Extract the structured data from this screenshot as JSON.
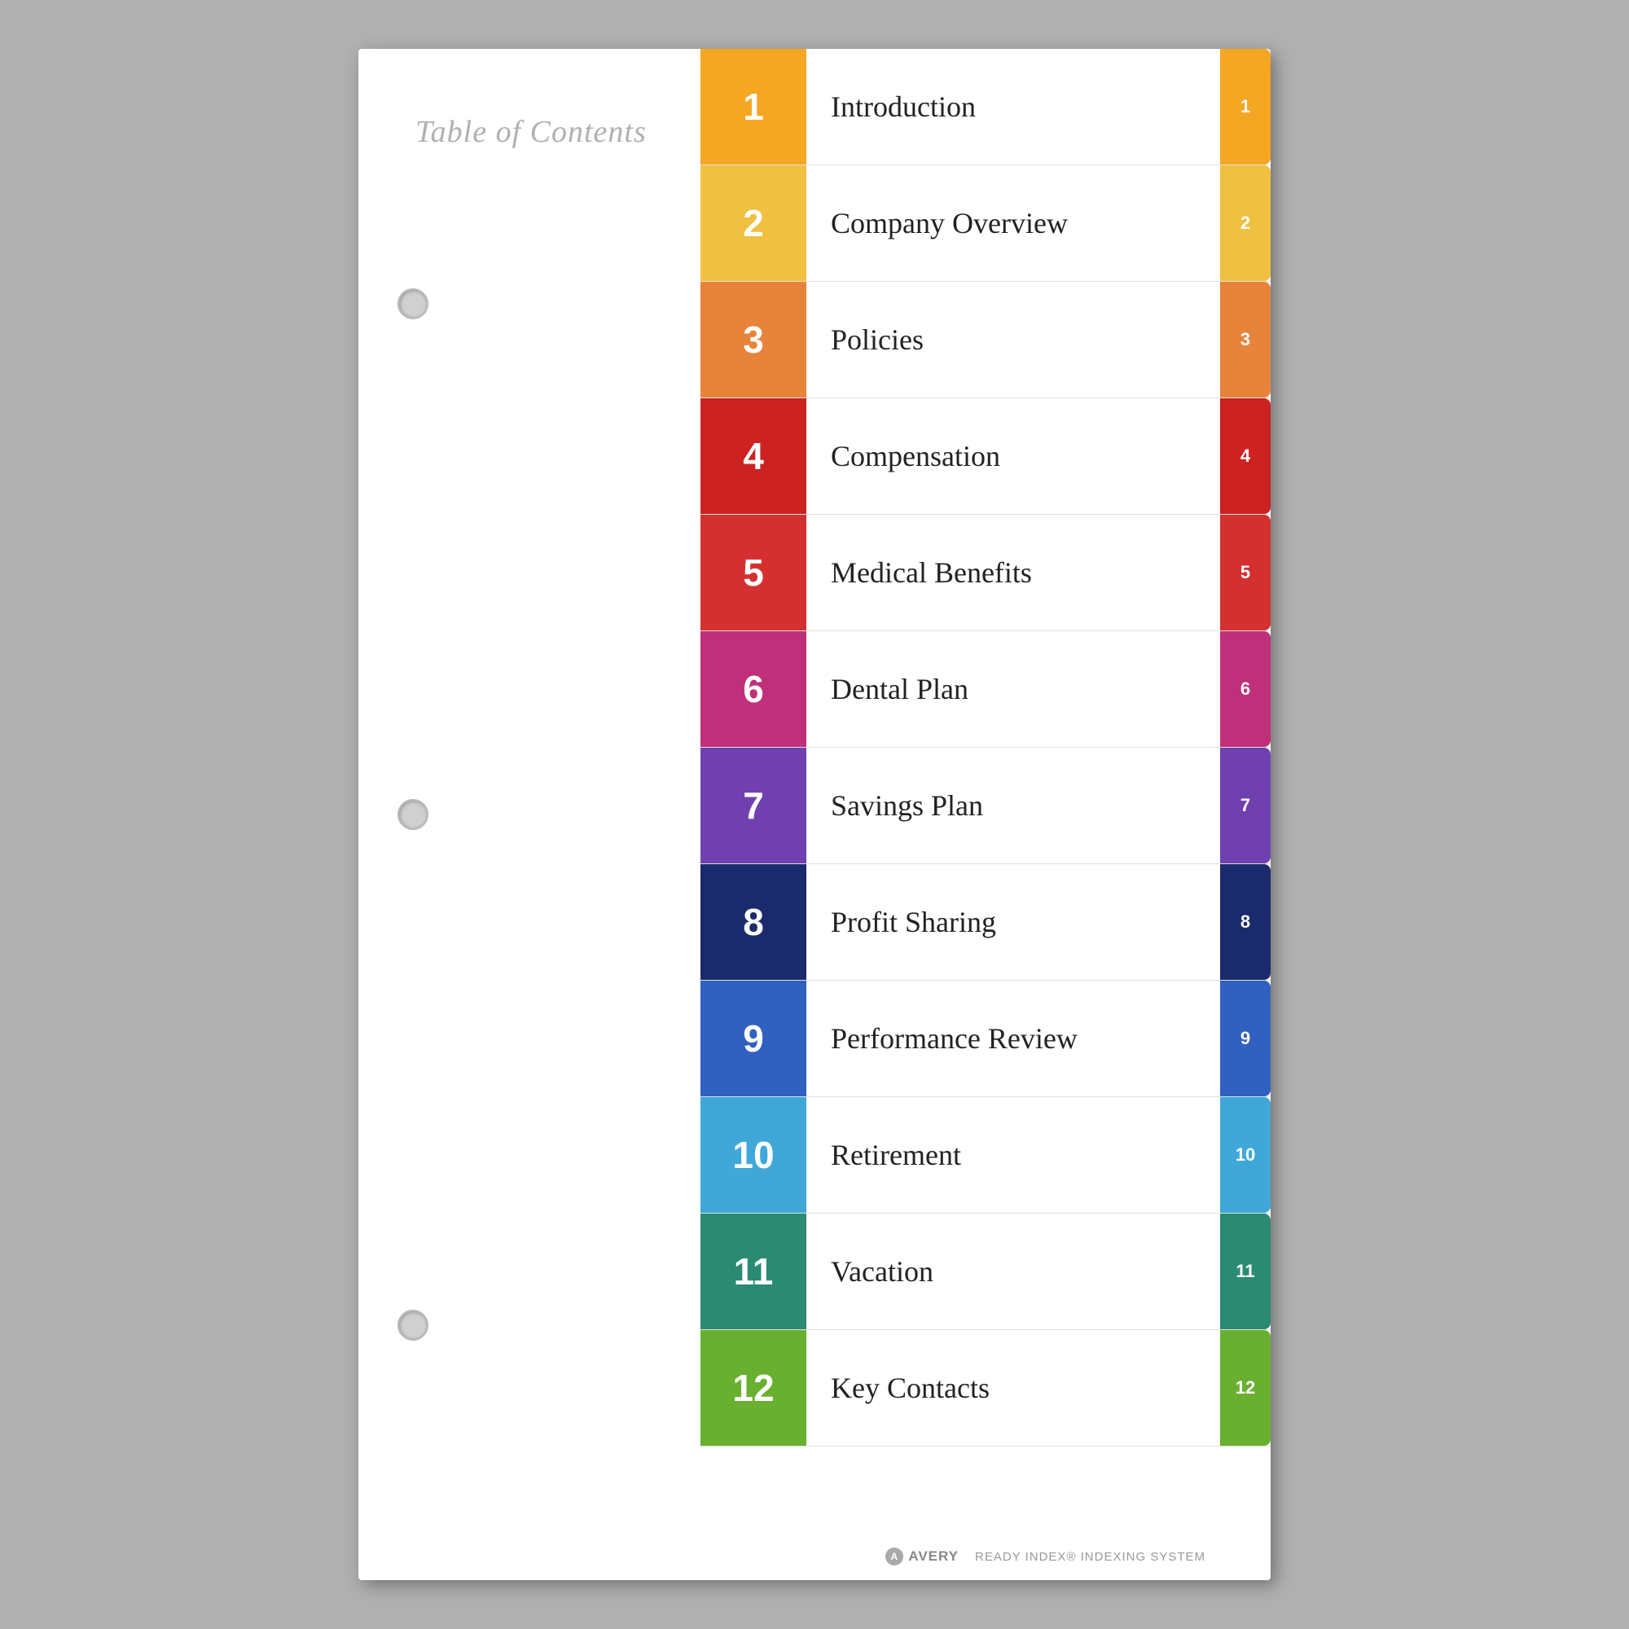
{
  "title": "Table of Contents",
  "entries": [
    {
      "num": "1",
      "label": "Introduction",
      "class": "entry-1"
    },
    {
      "num": "2",
      "label": "Company Overview",
      "class": "entry-2"
    },
    {
      "num": "3",
      "label": "Policies",
      "class": "entry-3"
    },
    {
      "num": "4",
      "label": "Compensation",
      "class": "entry-4"
    },
    {
      "num": "5",
      "label": "Medical Benefits",
      "class": "entry-5"
    },
    {
      "num": "6",
      "label": "Dental Plan",
      "class": "entry-6"
    },
    {
      "num": "7",
      "label": "Savings Plan",
      "class": "entry-7"
    },
    {
      "num": "8",
      "label": "Profit Sharing",
      "class": "entry-8"
    },
    {
      "num": "9",
      "label": "Performance Review",
      "class": "entry-9"
    },
    {
      "num": "10",
      "label": "Retirement",
      "class": "entry-10"
    },
    {
      "num": "11",
      "label": "Vacation",
      "class": "entry-11"
    },
    {
      "num": "12",
      "label": "Key Contacts",
      "class": "entry-12"
    }
  ],
  "footer": {
    "brand": "AVERY",
    "tagline": "READY INDEX® INDEXING SYSTEM"
  }
}
